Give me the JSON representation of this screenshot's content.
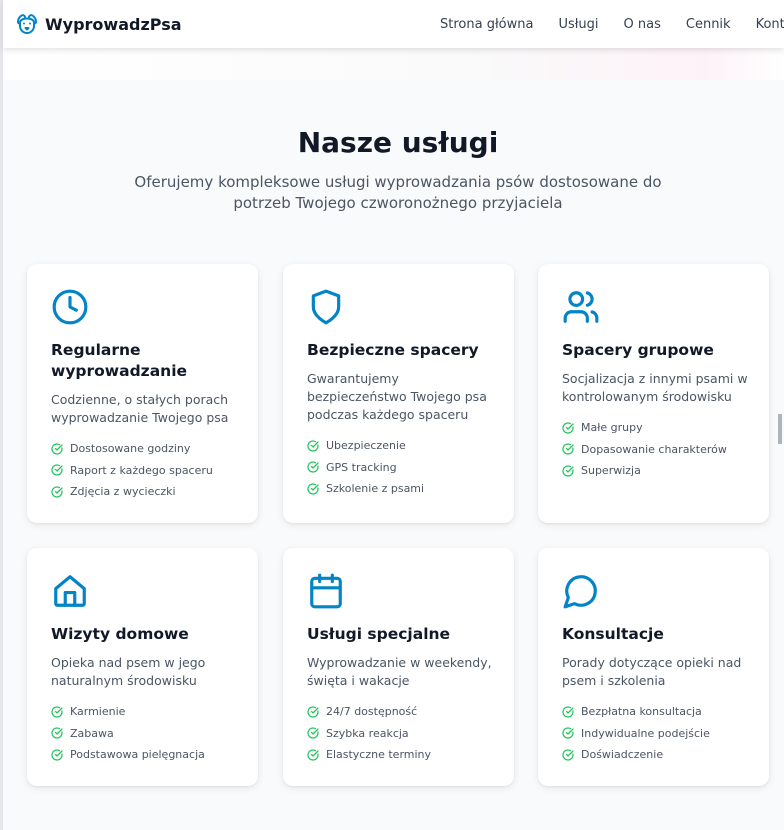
{
  "brand": {
    "name": "WyprowadzPsa",
    "icon": "dog-face-icon"
  },
  "nav": {
    "items": [
      {
        "label": "Strona główna"
      },
      {
        "label": "Usługi"
      },
      {
        "label": "O nas"
      },
      {
        "label": "Cennik"
      },
      {
        "label": "Konta"
      }
    ]
  },
  "services": {
    "title": "Nasze usługi",
    "subtitle": "Oferujemy kompleksowe usługi wyprowadzania psów dostosowane do potrzeb Twojego czworonożnego przyjaciela",
    "cards": [
      {
        "icon": "clock-icon",
        "title": "Regularne wyprowadzanie",
        "description": "Codzienne, o stałych porach wyprowadzanie Twojego psa",
        "features": [
          "Dostosowane godziny",
          "Raport z każdego spaceru",
          "Zdjęcia z wycieczki"
        ]
      },
      {
        "icon": "shield-icon",
        "title": "Bezpieczne spacery",
        "description": "Gwarantujemy bezpieczeństwo Twojego psa podczas każdego spaceru",
        "features": [
          "Ubezpieczenie",
          "GPS tracking",
          "Szkolenie z psami"
        ]
      },
      {
        "icon": "users-icon",
        "title": "Spacery grupowe",
        "description": "Socjalizacja z innymi psami w kontrolowanym środowisku",
        "features": [
          "Małe grupy",
          "Dopasowanie charakterów",
          "Superwizja"
        ]
      },
      {
        "icon": "home-icon",
        "title": "Wizyty domowe",
        "description": "Opieka nad psem w jego naturalnym środowisku",
        "features": [
          "Karmienie",
          "Zabawa",
          "Podstawowa pielęgnacja"
        ]
      },
      {
        "icon": "calendar-icon",
        "title": "Usługi specjalne",
        "description": "Wyprowadzanie w weekendy, święta i wakacje",
        "features": [
          "24/7 dostępność",
          "Szybka reakcja",
          "Elastyczne terminy"
        ]
      },
      {
        "icon": "message-circle-icon",
        "title": "Konsultacje",
        "description": "Porady dotyczące opieki nad psem i szkolenia",
        "features": [
          "Bezpłatna konsultacja",
          "Indywidualne podejście",
          "Doświadczenie"
        ]
      }
    ]
  },
  "colors": {
    "accent": "#0284c7",
    "check": "#22c55e",
    "heading": "#111827",
    "body": "#4b5563",
    "section_bg": "#f9fafb"
  }
}
